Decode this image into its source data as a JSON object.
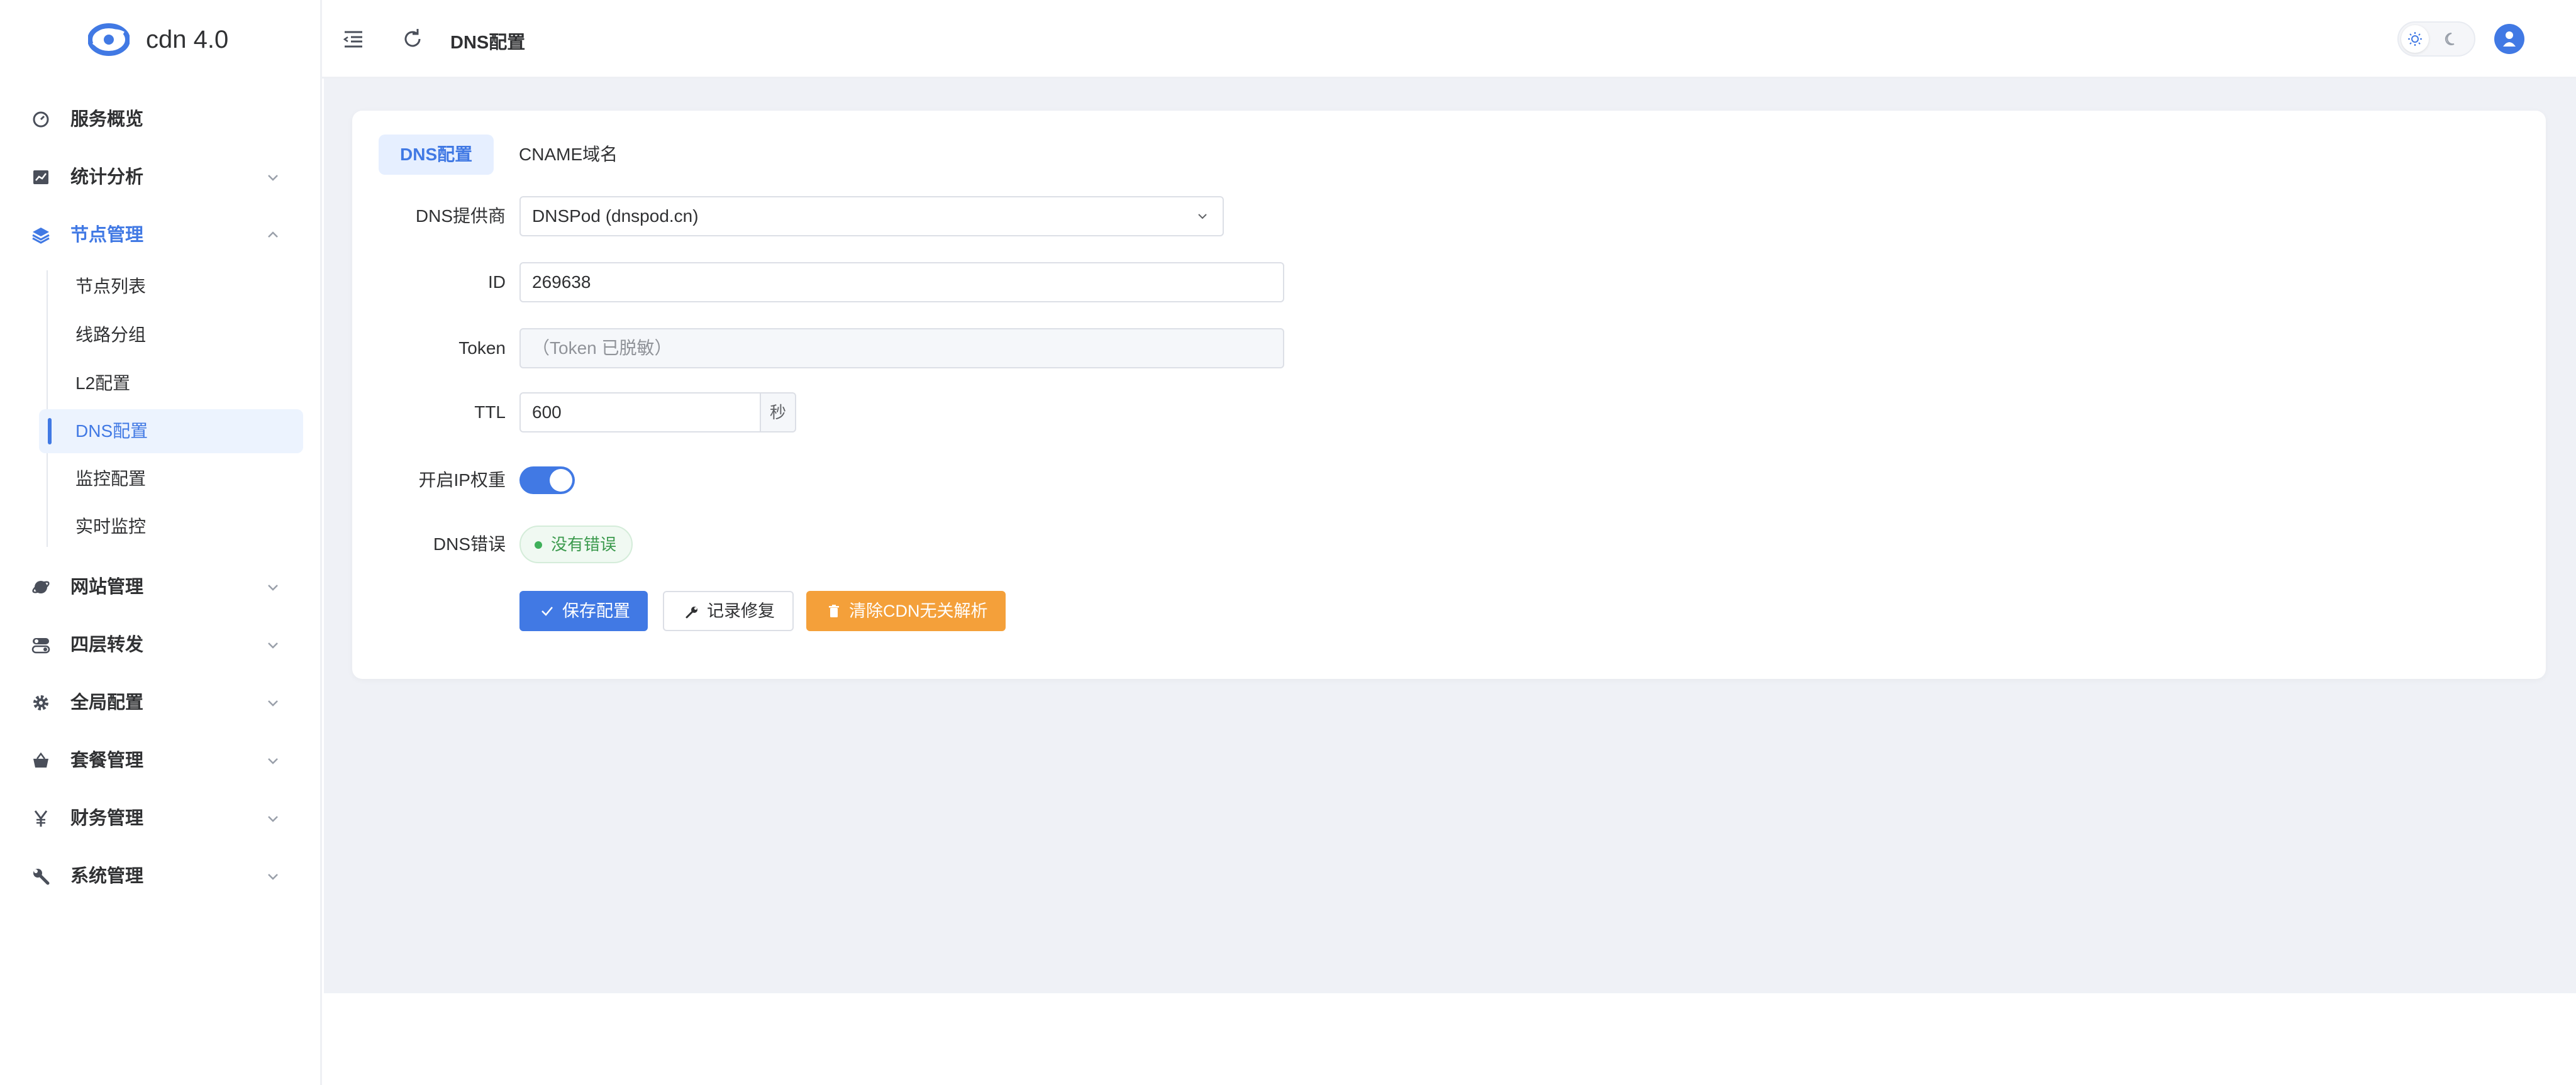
{
  "app": {
    "name": "cdn 4.0"
  },
  "header": {
    "title": "DNS配置"
  },
  "sidebar": {
    "items": [
      {
        "label": "服务概览",
        "icon": "dashboard-icon"
      },
      {
        "label": "统计分析",
        "icon": "chart-icon"
      },
      {
        "label": "节点管理",
        "icon": "layers-icon",
        "expanded": true
      },
      {
        "label": "网站管理",
        "icon": "globe-icon"
      },
      {
        "label": "四层转发",
        "icon": "toggle-icon"
      },
      {
        "label": "全局配置",
        "icon": "gear-icon"
      },
      {
        "label": "套餐管理",
        "icon": "basket-icon"
      },
      {
        "label": "财务管理",
        "icon": "yen-icon"
      },
      {
        "label": "系统管理",
        "icon": "wrench-icon"
      }
    ],
    "sub_items": [
      {
        "label": "节点列表"
      },
      {
        "label": "线路分组"
      },
      {
        "label": "L2配置"
      },
      {
        "label": "DNS配置",
        "active": true
      },
      {
        "label": "监控配置"
      },
      {
        "label": "实时监控"
      }
    ]
  },
  "tabs": [
    {
      "label": "DNS配置",
      "active": true
    },
    {
      "label": "CNAME域名"
    }
  ],
  "form": {
    "provider": {
      "label": "DNS提供商",
      "value": "DNSPod (dnspod.cn)"
    },
    "id": {
      "label": "ID",
      "value": "269638"
    },
    "token": {
      "label": "Token",
      "placeholder": "（Token 已脱敏）"
    },
    "ttl": {
      "label": "TTL",
      "value": "600",
      "unit": "秒"
    },
    "ip_weight": {
      "label": "开启IP权重",
      "enabled": true
    },
    "dns_error": {
      "label": "DNS错误",
      "status": "没有错误"
    }
  },
  "buttons": {
    "save": "保存配置",
    "repair": "记录修复",
    "clear": "清除CDN无关解析"
  },
  "colors": {
    "accent": "#4179e4",
    "warning": "#f4a03a",
    "success": "#3fb05a",
    "background": "#eff1f6"
  }
}
